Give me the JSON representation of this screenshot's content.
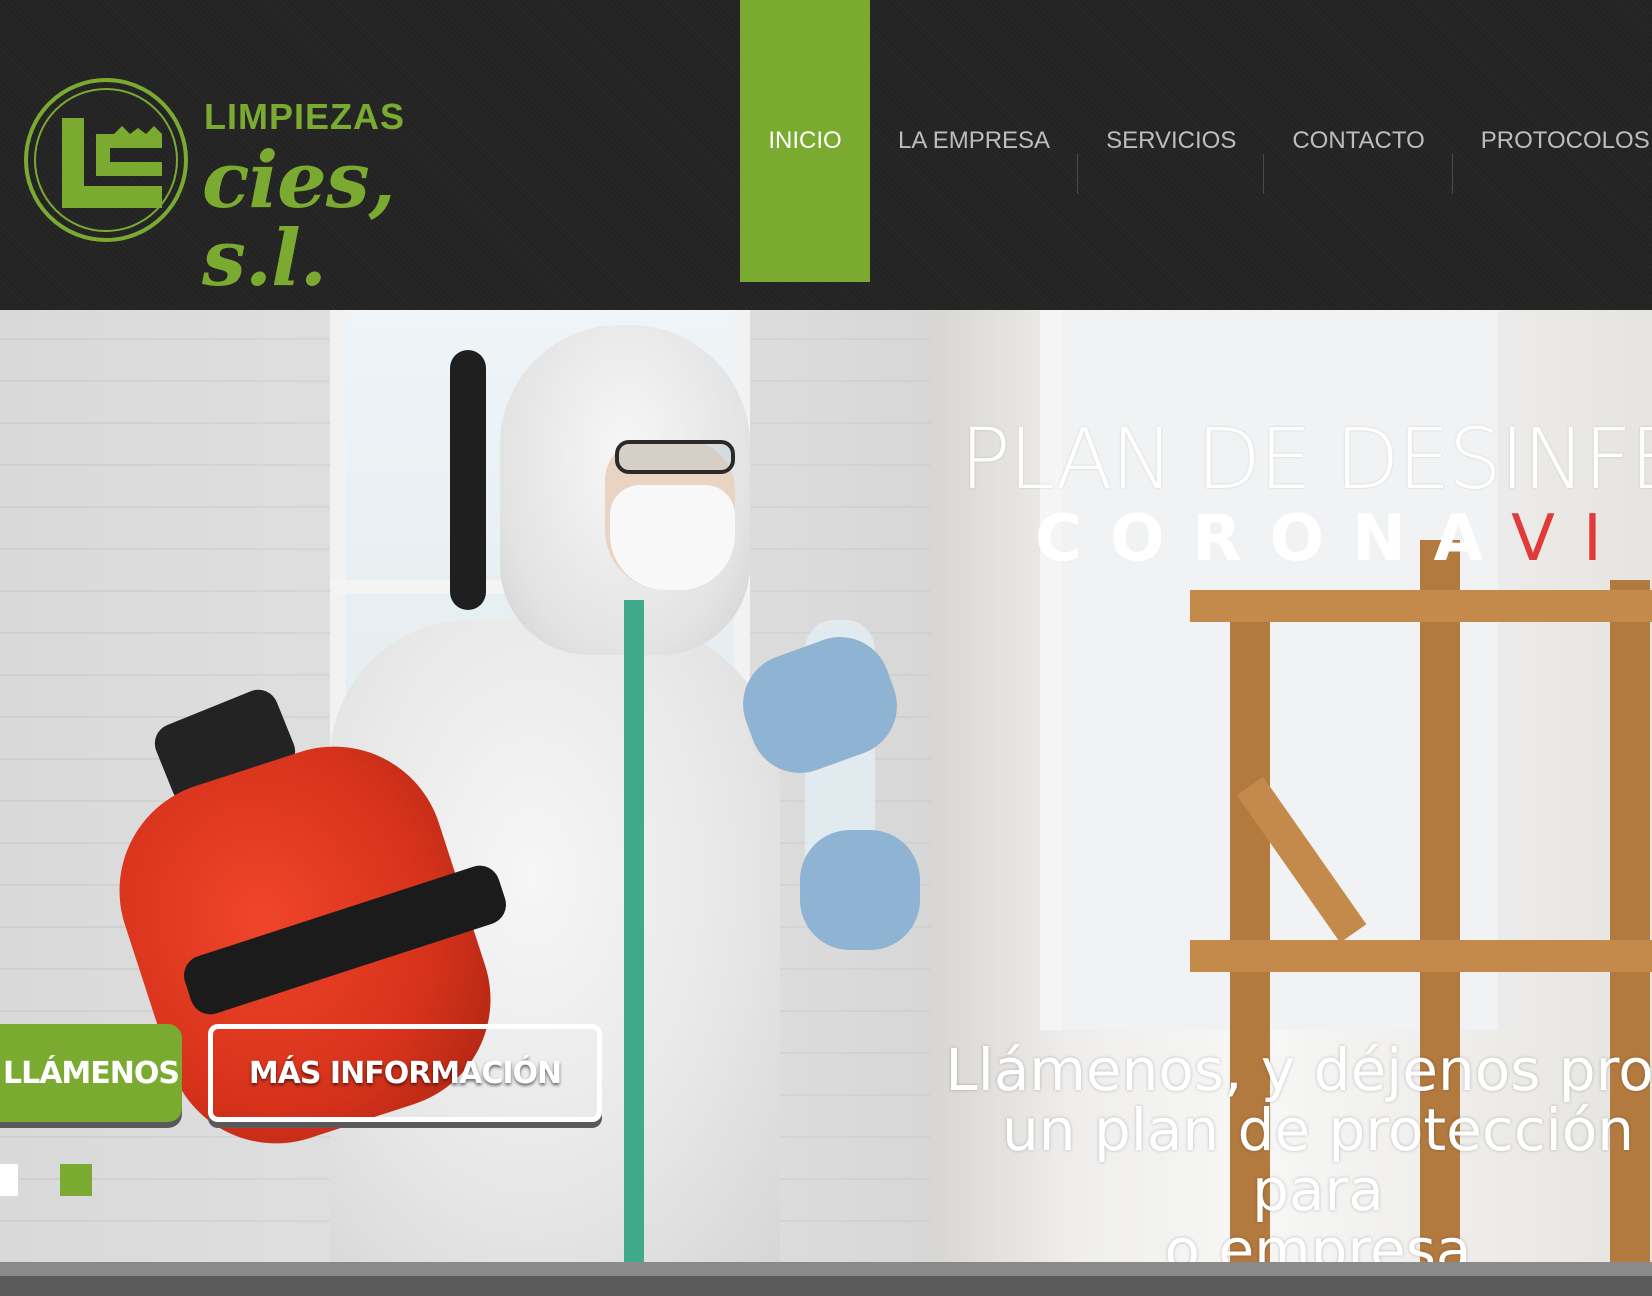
{
  "logo": {
    "line1": "LIMPIEZAS",
    "line2": "cies, s.l.",
    "color": "#7aab30"
  },
  "nav": {
    "items": [
      {
        "label": "INICIO",
        "active": true
      },
      {
        "label": "LA EMPRESA",
        "active": false
      },
      {
        "label": "SERVICIOS",
        "active": false
      },
      {
        "label": "CONTACTO",
        "active": false
      },
      {
        "label": "PROTOCOLOS",
        "active": false
      }
    ],
    "accent": "#7aab30"
  },
  "hero": {
    "title": "PLAN  DE DESINFEC",
    "corona_white": "CORONA",
    "corona_red": "VI",
    "subtitle_lines": [
      "Llámenos, y déjenos prop",
      "un plan de protección para",
      "o empresa"
    ],
    "buttons": {
      "call": "LLÁMENOS",
      "info": "MÁS INFORMACIÓN"
    },
    "slides": 2,
    "active_slide": 2
  },
  "colors": {
    "header_bg": "#232323",
    "nav_text": "#bdbdbd",
    "corona_red": "#e03a3a"
  }
}
